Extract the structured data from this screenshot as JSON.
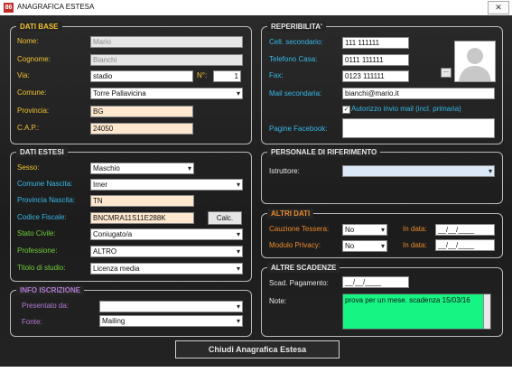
{
  "window": {
    "title": "ANAGRAFICA ESTESA",
    "close_glyph": "✕",
    "icon_text": "86"
  },
  "dati_base": {
    "title": "DATI BASE",
    "nome_label": "Nome:",
    "nome_value": "Mario",
    "cognome_label": "Cognome:",
    "cognome_value": "Bianchi",
    "via_label": "Via:",
    "via_value": "stadio",
    "numero_label": "N°:",
    "numero_value": "1",
    "comune_label": "Comune:",
    "comune_value": "Torre Pallavicina",
    "provincia_label": "Provincia:",
    "provincia_value": "BG",
    "cap_label": "C.A.P.:",
    "cap_value": "24050"
  },
  "dati_estesi": {
    "title": "DATI ESTESI",
    "sesso_label": "Sesso:",
    "sesso_value": "Maschio",
    "comune_nascita_label": "Comune Nascita:",
    "comune_nascita_value": "Imer",
    "provincia_nascita_label": "Provincia Nascita:",
    "provincia_nascita_value": "TN",
    "codice_fiscale_label": "Codice Fiscale:",
    "codice_fiscale_value": "BNCMRA11S11E288K",
    "calc_button": "Calc.",
    "stato_civile_label": "Stato Civile:",
    "stato_civile_value": "Coniugato/a",
    "professione_label": "Professione:",
    "professione_value": "ALTRO",
    "titolo_studio_label": "Titolo di studio:",
    "titolo_studio_value": "Licenza media"
  },
  "info_iscrizione": {
    "title": "INFO ISCRIZIONE",
    "presentato_label": "Presentato da:",
    "presentato_value": "",
    "fonte_label": "Fonte:",
    "fonte_value": "Mailing"
  },
  "reperibilita": {
    "title": "REPERIBILITA'",
    "cell_label": "Cell. secondario:",
    "cell_value": "111 111111",
    "tel_label": "Telefono Casa:",
    "tel_value": "0111 111111",
    "fax_label": "Fax:",
    "fax_value": "0123 111111",
    "mail_label": "Mail secondaria:",
    "mail_value": "bianchi@mario.it",
    "autorizzo_label": "Autorizzo invio mail (incl. primaria)",
    "autorizzo_checked": true,
    "check_glyph": "✓",
    "facebook_label": "Pagine Facebook:",
    "facebook_value": "",
    "photo_button": "..."
  },
  "personale": {
    "title": "PERSONALE DI RIFERIMENTO",
    "istruttore_label": "Istruttore:",
    "istruttore_value": ""
  },
  "altri_dati": {
    "title": "ALTRI DATI",
    "cauzione_label": "Cauzione Tessera:",
    "cauzione_value": "No",
    "cauzione_data_label": "In data:",
    "cauzione_data_value": "__/__/____",
    "privacy_label": "Modulo Privacy:",
    "privacy_value": "No",
    "privacy_data_label": "In data:",
    "privacy_data_value": "__/__/____"
  },
  "altre_scadenze": {
    "title": "ALTRE SCADENZE",
    "scad_label": "Scad. Pagamento:",
    "scad_value": "__/__/____",
    "note_label": "Note:",
    "note_value": "prova per un mese. scadenza 15/03/16"
  },
  "bottom": {
    "close_button": "Chiudi Anagrafica Estesa"
  }
}
